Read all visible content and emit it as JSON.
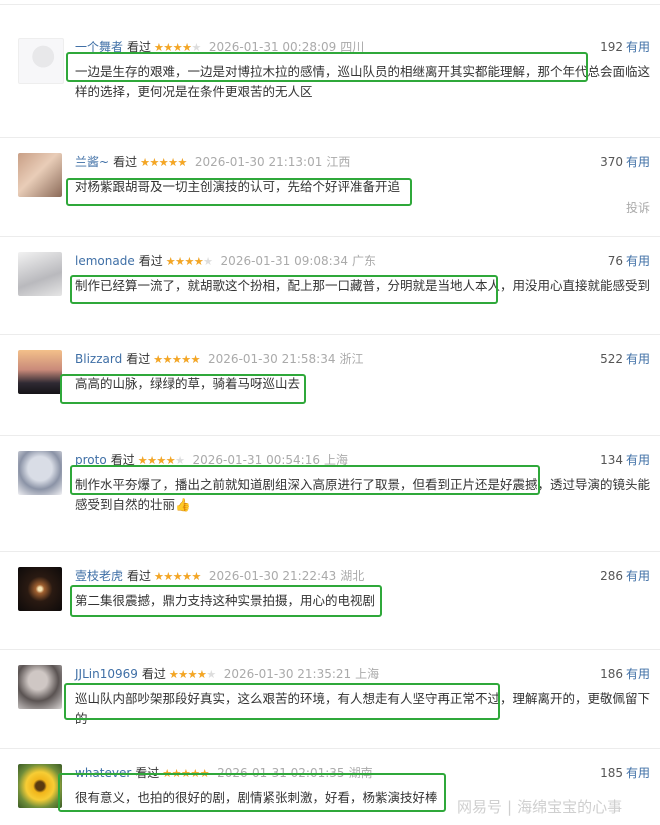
{
  "colors": {
    "highlight": "#2fa83a",
    "username": "#3f6fa6",
    "star": "#f5a623"
  },
  "reviews": [
    {
      "user": "一个舞者",
      "watched": "看过",
      "rating": 4,
      "time": "2026-01-31 00:28:09",
      "location": "四川",
      "votes": "192",
      "useful": "有用",
      "text": "一边是生存的艰难，一边是对博拉木拉的感情，巡山队员的相继离开其实都能理解，那个年代总会面临这样的选择，更何况是在条件更艰苦的无人区"
    },
    {
      "user": "兰酱~",
      "watched": "看过",
      "rating": 5,
      "time": "2026-01-30 21:13:01",
      "location": "江西",
      "votes": "370",
      "useful": "有用",
      "text": "对杨紫跟胡哥及一切主创演技的认可，先给个好评准备开追",
      "report": "投诉"
    },
    {
      "user": "lemonade",
      "watched": "看过",
      "rating": 4,
      "time": "2026-01-31 09:08:34",
      "location": "广东",
      "votes": "76",
      "useful": "有用",
      "text": "制作已经算一流了，就胡歌这个扮相，配上那一口藏普，分明就是当地人本人，用没用心直接就能感受到"
    },
    {
      "user": "Blizzard",
      "watched": "看过",
      "rating": 5,
      "time": "2026-01-30 21:58:34",
      "location": "浙江",
      "votes": "522",
      "useful": "有用",
      "text": "高高的山脉，绿绿的草，骑着马呀巡山去"
    },
    {
      "user": "proto",
      "watched": "看过",
      "rating": 4,
      "time": "2026-01-31 00:54:16",
      "location": "上海",
      "votes": "134",
      "useful": "有用",
      "text": "制作水平夯爆了，播出之前就知道剧组深入高原进行了取景，但看到正片还是好震撼，透过导演的镜头能感受到自然的壮丽👍"
    },
    {
      "user": "壹枝老虎",
      "watched": "看过",
      "rating": 5,
      "time": "2026-01-30 21:22:43",
      "location": "湖北",
      "votes": "286",
      "useful": "有用",
      "text": "第二集很震撼，鼎力支持这种实景拍摄，用心的电视剧"
    },
    {
      "user": "JJLin10969",
      "watched": "看过",
      "rating": 4,
      "time": "2026-01-30 21:35:21",
      "location": "上海",
      "votes": "186",
      "useful": "有用",
      "text": "巡山队内部吵架那段好真实，这么艰苦的环境，有人想走有人坚守再正常不过，理解离开的，更敬佩留下的"
    },
    {
      "user": "whatever",
      "watched": "看过",
      "rating": 5,
      "time": "2026-01-31 02:01:35",
      "location": "湖南",
      "votes": "185",
      "useful": "有用",
      "text": "很有意义，也拍的很好的剧，剧情紧张刺激，好看，杨紫演技好棒"
    }
  ],
  "watermark": {
    "brand": "网易号",
    "author": "海绵宝宝的心事"
  }
}
